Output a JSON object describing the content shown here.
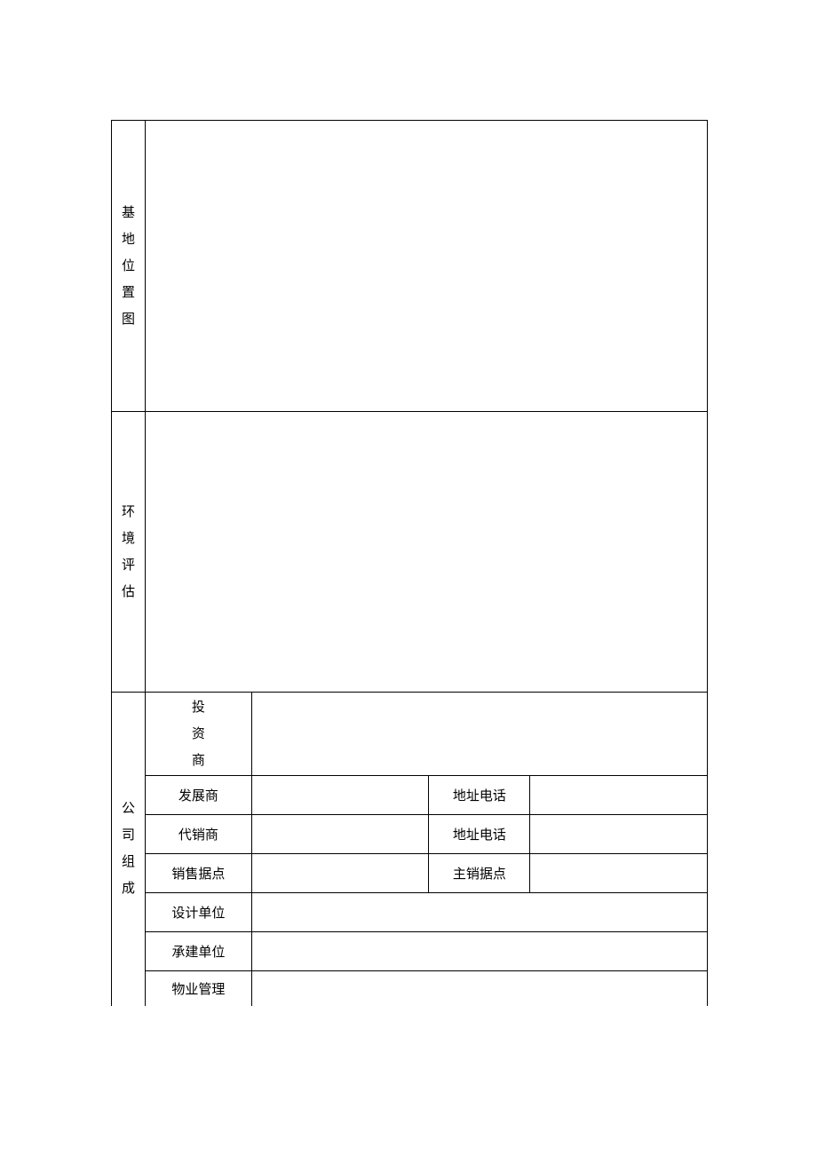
{
  "labels": {
    "section1": "基地位置图",
    "section2": "环境评估",
    "section3": "公司组成"
  },
  "company_rows": {
    "investor": "投资商",
    "developer": "发展商",
    "developer_addr": "地址电话",
    "agent": "代销商",
    "agent_addr": "地址电话",
    "sales_point": "销售据点",
    "main_sales_point": "主销据点",
    "design_unit": "设计单位",
    "construction_unit": "承建单位",
    "property_mgmt": "物业管理"
  },
  "values": {
    "section1_content": "",
    "section2_content": "",
    "investor_val": "",
    "developer_val": "",
    "developer_addr_val": "",
    "agent_val": "",
    "agent_addr_val": "",
    "sales_point_val": "",
    "main_sales_point_val": "",
    "design_unit_val": "",
    "construction_unit_val": "",
    "property_mgmt_val": ""
  }
}
